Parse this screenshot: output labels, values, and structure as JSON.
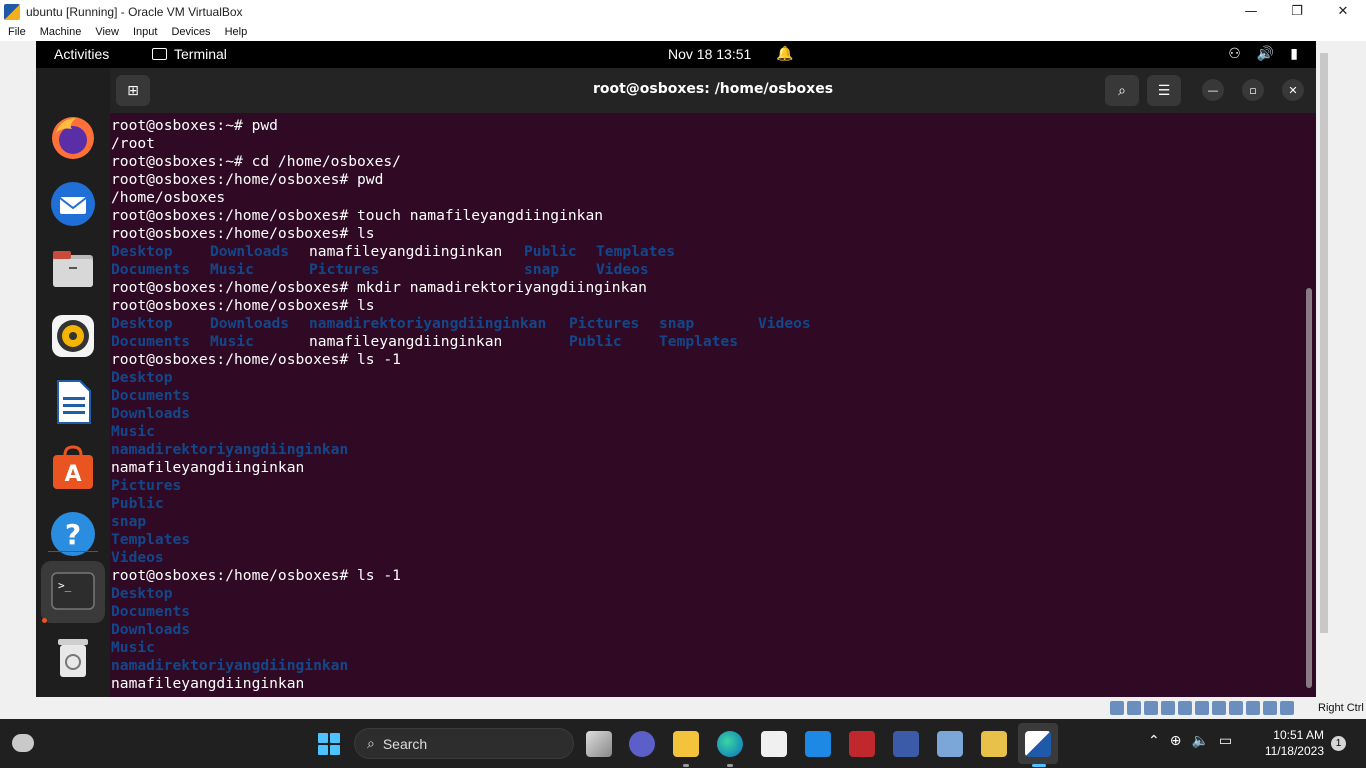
{
  "host_window": {
    "title": "ubuntu [Running] - Oracle VM VirtualBox",
    "menu": [
      "File",
      "Machine",
      "View",
      "Input",
      "Devices",
      "Help"
    ],
    "controls": {
      "minimize": "—",
      "restore": "❐",
      "close": "✕"
    },
    "host_key": "Right Ctrl"
  },
  "gnome_topbar": {
    "activities": "Activities",
    "app_name": "Terminal",
    "clock": "Nov 18  13:51",
    "bell_icon": "🔔",
    "network_icon": "⚇",
    "volume_icon": "🔊",
    "battery_icon": "▮"
  },
  "dock": {
    "items": [
      "firefox-icon",
      "thunderbird-icon",
      "files-icon",
      "rhythmbox-icon",
      "writer-icon",
      "software-icon",
      "help-icon",
      "terminal-icon",
      "trash-icon"
    ]
  },
  "terminal": {
    "title": "root@osboxes: /home/osboxes",
    "newtab_icon": "⊞",
    "search_icon": "⌕",
    "menu_icon": "☰",
    "min_icon": "—",
    "max_icon": "▫",
    "close_icon": "✕",
    "lines": {
      "l1": "root@osboxes:~# pwd",
      "l2": "/root",
      "l3": "root@osboxes:~# cd /home/osboxes/",
      "l4": "root@osboxes:/home/osboxes# pwd",
      "l5": "/home/osboxes",
      "l6": "root@osboxes:/home/osboxes# touch namafileyangdiinginkan",
      "l7": "root@osboxes:/home/osboxes# ls",
      "l10": "root@osboxes:/home/osboxes# mkdir namadirektoriyangdiinginkan",
      "l11": "root@osboxes:/home/osboxes# ls",
      "l14": "root@osboxes:/home/osboxes# ls -1",
      "l26": "root@osboxes:/home/osboxes# ls -1"
    },
    "ls1": {
      "row1": [
        "Desktop",
        "Downloads",
        "namafileyangdiinginkan",
        "Public",
        "Templates"
      ],
      "row2": [
        "Documents",
        "Music",
        "Pictures",
        "snap",
        "Videos"
      ]
    },
    "ls2": {
      "row1": [
        "Desktop",
        "Downloads",
        "namadirektoriyangdiinginkan",
        "Pictures",
        "snap",
        "Videos"
      ],
      "row2": [
        "Documents",
        "Music",
        "namafileyangdiinginkan",
        "Public",
        "Templates"
      ]
    },
    "ls_1_a": [
      "Desktop",
      "Documents",
      "Downloads",
      "Music",
      "namadirektoriyangdiinginkan",
      "namafileyangdiinginkan",
      "Pictures",
      "Public",
      "snap",
      "Templates",
      "Videos"
    ],
    "ls_1_b": [
      "Desktop",
      "Documents",
      "Downloads",
      "Music",
      "namadirektoriyangdiinginkan",
      "namafileyangdiinginkan"
    ]
  },
  "taskbar": {
    "search_label": "Search",
    "search_icon": "⌕",
    "time": "10:51 AM",
    "date": "11/18/2023",
    "notification_count": "1",
    "tray_chevron": "⌃",
    "tray_globe": "⊕",
    "tray_volume": "🔈",
    "tray_battery": "▭"
  },
  "colors": {
    "terminal_bg": "#300a24",
    "dir_color": "#12488b",
    "accent": "#e95420"
  }
}
